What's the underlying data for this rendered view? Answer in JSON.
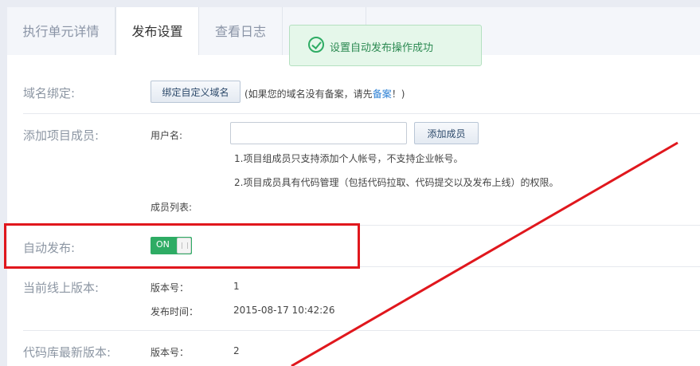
{
  "tabs": [
    {
      "label": "执行单元详情"
    },
    {
      "label": "发布设置"
    },
    {
      "label": "查看日志"
    },
    {
      "label": ""
    }
  ],
  "toast": {
    "message": "设置自动发布操作成功"
  },
  "domain": {
    "label": "域名绑定:",
    "button": "绑定自定义域名",
    "note_prefix": "(如果您的域名没有备案，请先",
    "note_link": "备案",
    "note_suffix": "！)"
  },
  "members": {
    "label": "添加项目成员:",
    "username_label": "用户名:",
    "username_value": "",
    "add_button": "添加成员",
    "note1": "1.项目组成员只支持添加个人帐号，不支持企业帐号。",
    "note2": "2.项目成员具有代码管理（包括代码拉取、代码提交以及发布上线）的权限。",
    "list_label": "成员列表:"
  },
  "auto_publish": {
    "label": "自动发布:",
    "toggle_text": "ON",
    "enabled": true
  },
  "online_version": {
    "label": "当前线上版本:",
    "version_label": "版本号：",
    "version_value": "1",
    "time_label": "发布时间：",
    "time_value": "2015-08-17 10:42:26"
  },
  "repo_version": {
    "label": "代码库最新版本:",
    "version_label": "版本号：",
    "version_value": "2"
  },
  "colors": {
    "accent_green": "#2eac64",
    "annotation_red": "#e0171d",
    "link_blue": "#2a7fd4"
  }
}
